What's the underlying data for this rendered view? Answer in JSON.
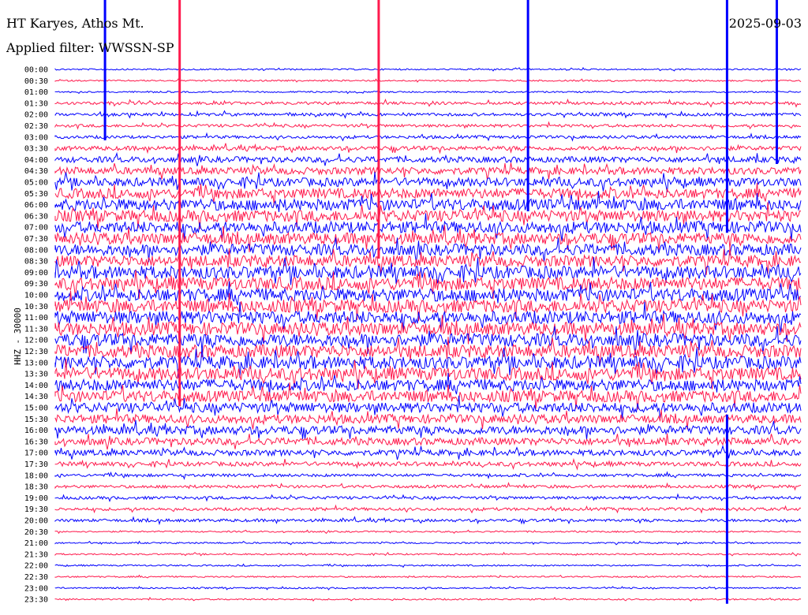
{
  "header": {
    "station": "HT Karyes, Athos Mt.",
    "filter": "Applied filter: WWSSN-SP",
    "date": "2025-09-03"
  },
  "chart_data": {
    "type": "line",
    "title": "",
    "ylabel": "HHZ - 30000",
    "row_labels": [
      "00:00",
      "00:30",
      "01:00",
      "01:30",
      "02:00",
      "02:30",
      "03:00",
      "03:30",
      "04:00",
      "04:30",
      "05:00",
      "05:30",
      "06:00",
      "06:30",
      "07:00",
      "07:30",
      "08:00",
      "08:30",
      "09:00",
      "09:30",
      "10:00",
      "10:30",
      "11:00",
      "11:30",
      "12:00",
      "12:30",
      "13:00",
      "13:30",
      "14:00",
      "14:30",
      "15:00",
      "15:30",
      "16:00",
      "16:30",
      "17:00",
      "17:30",
      "18:00",
      "18:30",
      "19:00",
      "19:30",
      "20:00",
      "20:30",
      "21:00",
      "21:30",
      "22:00",
      "22:30",
      "23:00",
      "23:30"
    ],
    "row_colors": [
      "#0000ff",
      "#ff1a4d"
    ],
    "noise_level": [
      1,
      1,
      1,
      2,
      2,
      2,
      2,
      3,
      4,
      5,
      6,
      7,
      8,
      8,
      8,
      8,
      8,
      8,
      9,
      9,
      9,
      9,
      9,
      9,
      9,
      9,
      9,
      9,
      8,
      8,
      7,
      6,
      6,
      5,
      4,
      3,
      2,
      2,
      2,
      2,
      2,
      1,
      1,
      1,
      1,
      1,
      1,
      1
    ],
    "events": [
      {
        "time_min": 2,
        "row": 0,
        "amp": 30,
        "color": "#0000ff"
      },
      {
        "time_min": 5,
        "row": 11,
        "amp": 90,
        "color": "#ff1a4d"
      },
      {
        "time_min": 13,
        "row": 0,
        "amp": 80,
        "color": "#ff1a4d"
      },
      {
        "time_min": 19,
        "row": 0,
        "amp": 60,
        "color": "#0000ff"
      },
      {
        "time_min": 27,
        "row": 4,
        "amp": 50,
        "color": "#0000ff"
      },
      {
        "time_min": 27,
        "row": 39,
        "amp": 40,
        "color": "#0000ff"
      },
      {
        "time_min": 29,
        "row": 0,
        "amp": 40,
        "color": "#0000ff"
      }
    ]
  }
}
